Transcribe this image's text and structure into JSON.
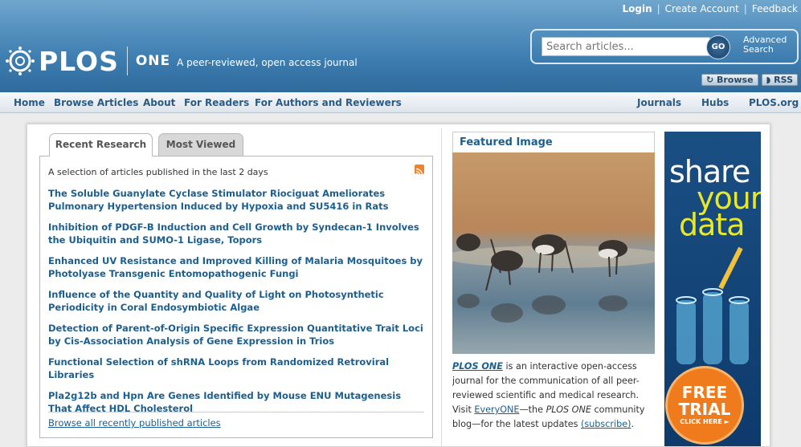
{
  "header": {
    "login": "Login",
    "create_account": "Create Account",
    "feedback": "Feedback",
    "logo_text": "PLOS",
    "journal": "ONE",
    "tagline": "A peer-reviewed, open access journal",
    "search_placeholder": "Search articles...",
    "go_label": "GO",
    "advanced_search": "Advanced Search",
    "browse_btn": "Browse",
    "rss_btn": "RSS"
  },
  "nav": {
    "left": [
      "Home",
      "Browse Articles",
      "About",
      "For Readers",
      "For Authors and Reviewers"
    ],
    "right": [
      "Journals",
      "Hubs",
      "PLOS.org"
    ]
  },
  "tabs": [
    "Recent Research",
    "Most Viewed"
  ],
  "recent": {
    "intro": "A selection of articles published in the last 2 days",
    "articles": [
      "The Soluble Guanylate Cyclase Stimulator Riociguat Ameliorates Pulmonary Hypertension Induced by Hypoxia and SU5416 in Rats",
      "Inhibition of PDGF-B Induction and Cell Growth by Syndecan-1 Involves the Ubiquitin and SUMO-1 Ligase, Topors",
      "Enhanced UV Resistance and Improved Killing of Malaria Mosquitoes by Photolyase Transgenic Entomopathogenic Fungi",
      "Influence of the Quantity and Quality of Light on Photosynthetic Periodicity in Coral Endosymbiotic Algae",
      "Detection of Parent-of-Origin Specific Expression Quantitative Trait Loci by Cis-Association Analysis of Gene Expression in Trios",
      "Functional Selection of shRNA Loops from Randomized Retroviral Libraries",
      "Pla2g12b and Hpn Are Genes Identified by Mouse ENU Mutagenesis That Affect HDL Cholesterol"
    ],
    "browse_all": "Browse all recently published articles"
  },
  "featured": {
    "title": "Featured Image",
    "desc_journal": "PLOS ONE",
    "desc_1": " is an interactive open-access journal for the communication of all peer-reviewed scientific and medical research. Visit ",
    "everyone": "EveryONE",
    "desc_2": "—the ",
    "desc_journal2": "PLOS ONE",
    "desc_3": " community blog—for the latest updates ",
    "subscribe": "(subscribe)",
    "desc_4": "."
  },
  "ad": {
    "line1": "share",
    "line2": "your",
    "line3": "data",
    "free": "FREE",
    "trial": "TRIAL",
    "click": "CLICK HERE ►"
  }
}
